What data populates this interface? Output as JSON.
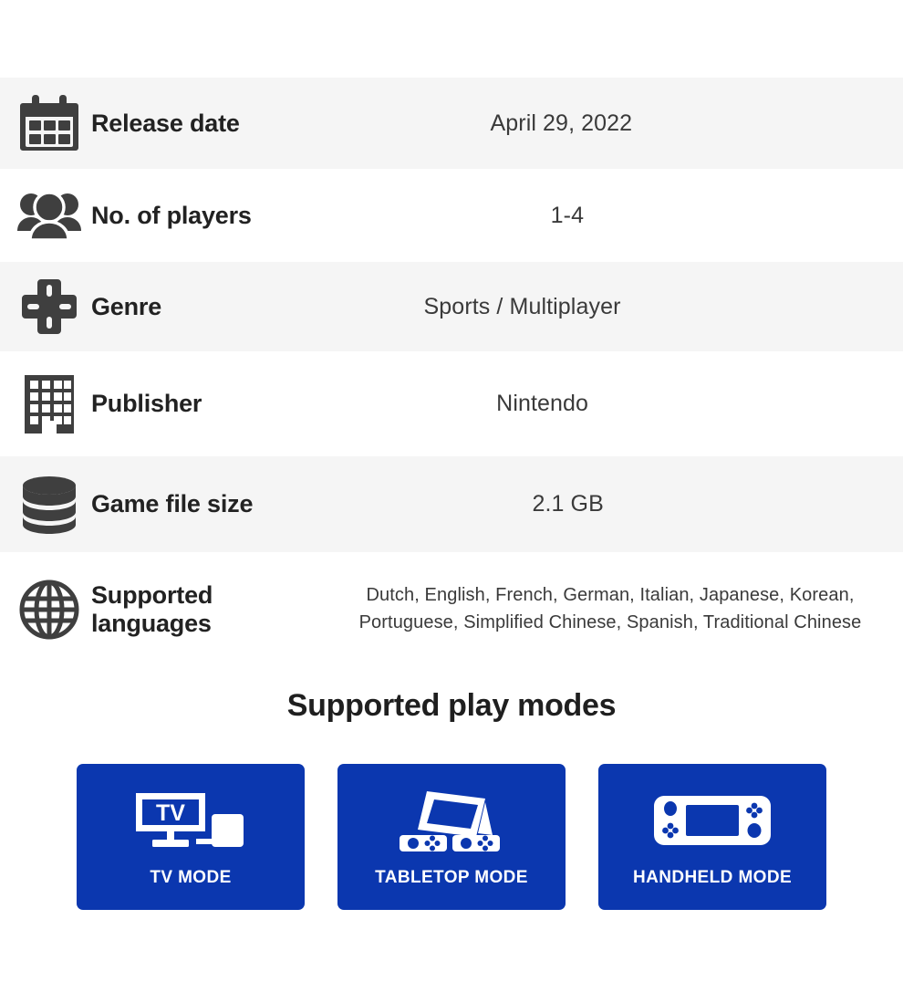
{
  "colors": {
    "accent_blue": "#0b37af",
    "row_shaded": "#f5f5f5",
    "row_plain": "#ffffff",
    "icon_dark": "#3f3f3f",
    "text_dark": "#222222"
  },
  "spec_rows": [
    {
      "icon": "calendar-icon",
      "label": "Release date",
      "value": "April 29, 2022"
    },
    {
      "icon": "players-icon",
      "label": "No. of players",
      "value": "1-4"
    },
    {
      "icon": "dpad-icon",
      "label": "Genre",
      "value": "Sports / Multiplayer"
    },
    {
      "icon": "building-icon",
      "label": "Publisher",
      "value": "Nintendo"
    },
    {
      "icon": "database-icon",
      "label": "Game file size",
      "value": "2.1 GB"
    },
    {
      "icon": "globe-icon",
      "label": "Supported\nlanguages",
      "value": "Dutch, English, French, German, Italian, Japanese, Korean, Portuguese, Simplified Chinese, Spanish, Traditional Chinese"
    }
  ],
  "play_modes": {
    "title": "Supported play modes",
    "cards": [
      {
        "icon": "tv-mode-icon",
        "label": "TV MODE",
        "screen_text": "TV"
      },
      {
        "icon": "tabletop-mode-icon",
        "label": "TABLETOP MODE"
      },
      {
        "icon": "handheld-mode-icon",
        "label": "HANDHELD MODE"
      }
    ]
  }
}
